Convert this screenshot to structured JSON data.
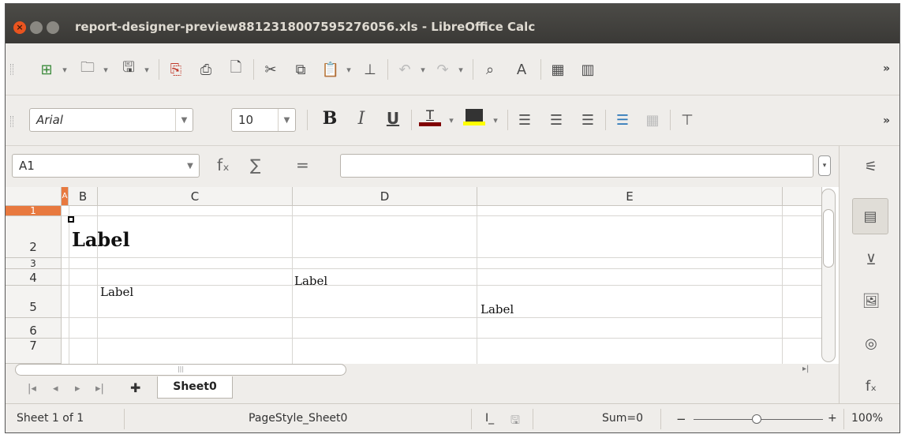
{
  "window": {
    "title": "report-designer-preview8812318007595276056.xls - LibreOffice Calc"
  },
  "toolbar1": {
    "more": "»"
  },
  "toolbar2": {
    "font_name": "Arial",
    "font_size": "10",
    "bold": "B",
    "italic": "I",
    "underline": "U",
    "more": "»",
    "font_color": "#800000",
    "highlight_color": "#ffff00"
  },
  "formula": {
    "cell_ref": "A1",
    "fx": "fₓ",
    "sum": "∑",
    "equals": "=",
    "value": ""
  },
  "grid": {
    "columns": [
      "A",
      "B",
      "C",
      "D",
      "E"
    ],
    "rows": [
      "1",
      "2",
      "3",
      "4",
      "5",
      "6",
      "7"
    ],
    "cells": {
      "c2": "Label",
      "c4": "Label",
      "d3": "Label",
      "e5": "Label"
    },
    "accent": "#e8793f"
  },
  "tabs": {
    "sheet": "Sheet0"
  },
  "status": {
    "sheet_info": "Sheet 1 of 1",
    "page_style": "PageStyle_Sheet0",
    "sum": "Sum=0",
    "zoom": "100%",
    "zoom_minus": "−",
    "zoom_plus": "+"
  }
}
